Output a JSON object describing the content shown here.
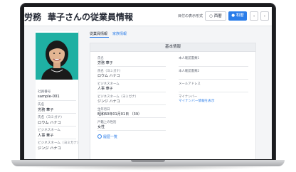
{
  "header": {
    "department": "労務",
    "title": "華子さんの従業員情報",
    "period_label": "目付の表示形式",
    "buttons": {
      "western": "西暦",
      "japanese": "和暦",
      "prev": "‹",
      "next": "›"
    },
    "icons": {
      "western": "radio-icon",
      "japanese": "radio-selected-icon"
    }
  },
  "profile": {
    "employee_no_label": "社員番号",
    "employee_no": "sample-001",
    "name_label": "氏名",
    "name": "労務 華子",
    "kana_label": "氏名（ヨミガナ）",
    "kana": "ロウム ハナコ",
    "business_name_label": "ビジネスネーム",
    "business_name": "人事 華子",
    "business_kana_label": "ビジネスネーム（ヨミガナ）",
    "business_kana": "ジンジ ハナコ"
  },
  "tabs": [
    {
      "label": "従業員情報"
    },
    {
      "label": "家族情報"
    }
  ],
  "panel": {
    "title": "基本情報",
    "left_fields": [
      {
        "label": "氏名",
        "value": "労務 華子"
      },
      {
        "label": "氏名（ヨミガナ）",
        "value": "ロウム ハナコ"
      },
      {
        "label": "ビジネスネーム",
        "value": "人事 華子"
      },
      {
        "label": "ビジネスネーム（ヨミガナ）",
        "value": "ジンジ ハナコ"
      },
      {
        "label": "生年月日",
        "value": "昭和60年01月01日 （39）"
      },
      {
        "label": "戸籍上の性別",
        "value": "女性"
      }
    ],
    "right_fields": [
      {
        "label": "本人確認書類1",
        "value": ""
      },
      {
        "label": "本人確認書類2",
        "value": ""
      },
      {
        "label": "メールアドレス",
        "value": ""
      },
      {
        "label": "マイナンバー",
        "value": "マイナンバー情報を表示"
      }
    ],
    "history_link": "履歴一覧"
  },
  "colors": {
    "accent": "#2b7de9",
    "photo_bg": "#1fb0a3"
  }
}
